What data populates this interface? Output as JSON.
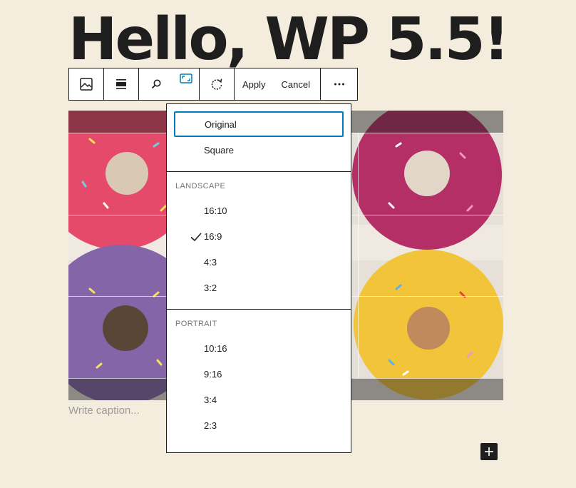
{
  "page": {
    "title": "Hello, WP 5.5!"
  },
  "toolbar": {
    "image_icon": "image-icon",
    "align_icon": "align-icon",
    "zoom_icon": "search-icon",
    "aspect_icon": "aspect-ratio-icon",
    "rotate_icon": "rotate-icon",
    "apply_label": "Apply",
    "cancel_label": "Cancel",
    "more_icon": "more-options-icon"
  },
  "aspect_menu": {
    "top_items": [
      {
        "label": "Original",
        "focused": true
      },
      {
        "label": "Square"
      }
    ],
    "landscape": {
      "heading": "Landscape",
      "items": [
        {
          "label": "16:10"
        },
        {
          "label": "16:9",
          "checked": true
        },
        {
          "label": "4:3"
        },
        {
          "label": "3:2"
        }
      ]
    },
    "portrait": {
      "heading": "Portrait",
      "items": [
        {
          "label": "10:16"
        },
        {
          "label": "9:16"
        },
        {
          "label": "3:4"
        },
        {
          "label": "2:3"
        }
      ]
    }
  },
  "image": {
    "caption_placeholder": "Write caption..."
  },
  "add_block": {
    "icon": "plus-icon"
  },
  "colors": {
    "background": "#f4eddd",
    "accent": "#007cba",
    "text": "#1e1e1e"
  }
}
